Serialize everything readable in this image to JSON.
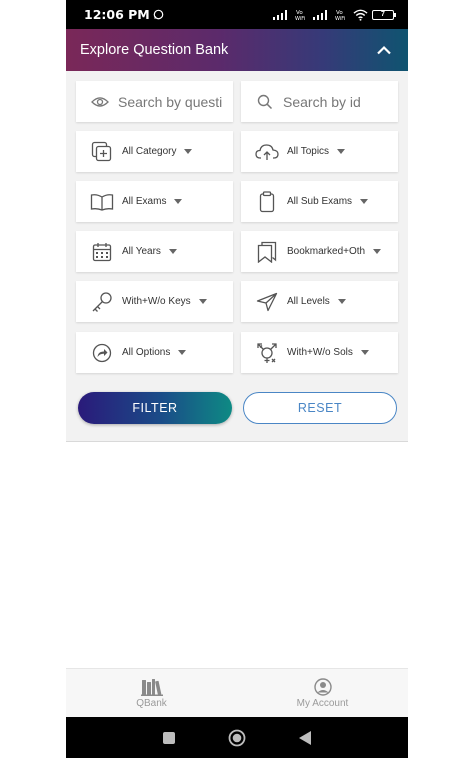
{
  "status_bar": {
    "time": "12:06 PM",
    "battery": "7"
  },
  "header": {
    "title": "Explore Question Bank"
  },
  "search": {
    "question_placeholder": "Search by questi",
    "id_placeholder": "Search by id"
  },
  "filters": [
    {
      "label": "All Category",
      "icon": "add-category-icon"
    },
    {
      "label": "All Topics",
      "icon": "cloud-upload-icon"
    },
    {
      "label": "All Exams",
      "icon": "book-icon"
    },
    {
      "label": "All Sub Exams",
      "icon": "clipboard-icon"
    },
    {
      "label": "All Years",
      "icon": "calendar-icon"
    },
    {
      "label": "Bookmarked+Oth",
      "icon": "bookmark-icon"
    },
    {
      "label": "With+W/o Keys",
      "icon": "key-icon"
    },
    {
      "label": "All Levels",
      "icon": "send-icon"
    },
    {
      "label": "All Options",
      "icon": "share-arrow-icon"
    },
    {
      "label": "With+W/o Sols",
      "icon": "gender-symbol-icon"
    }
  ],
  "buttons": {
    "filter": "FILTER",
    "reset": "RESET"
  },
  "bottom_nav": [
    {
      "label": "QBank",
      "icon": "books-icon"
    },
    {
      "label": "My Account",
      "icon": "account-icon"
    }
  ],
  "colors": {
    "accent": "#4a86c5",
    "header_start": "#7a2858",
    "header_end": "#0f5470"
  }
}
